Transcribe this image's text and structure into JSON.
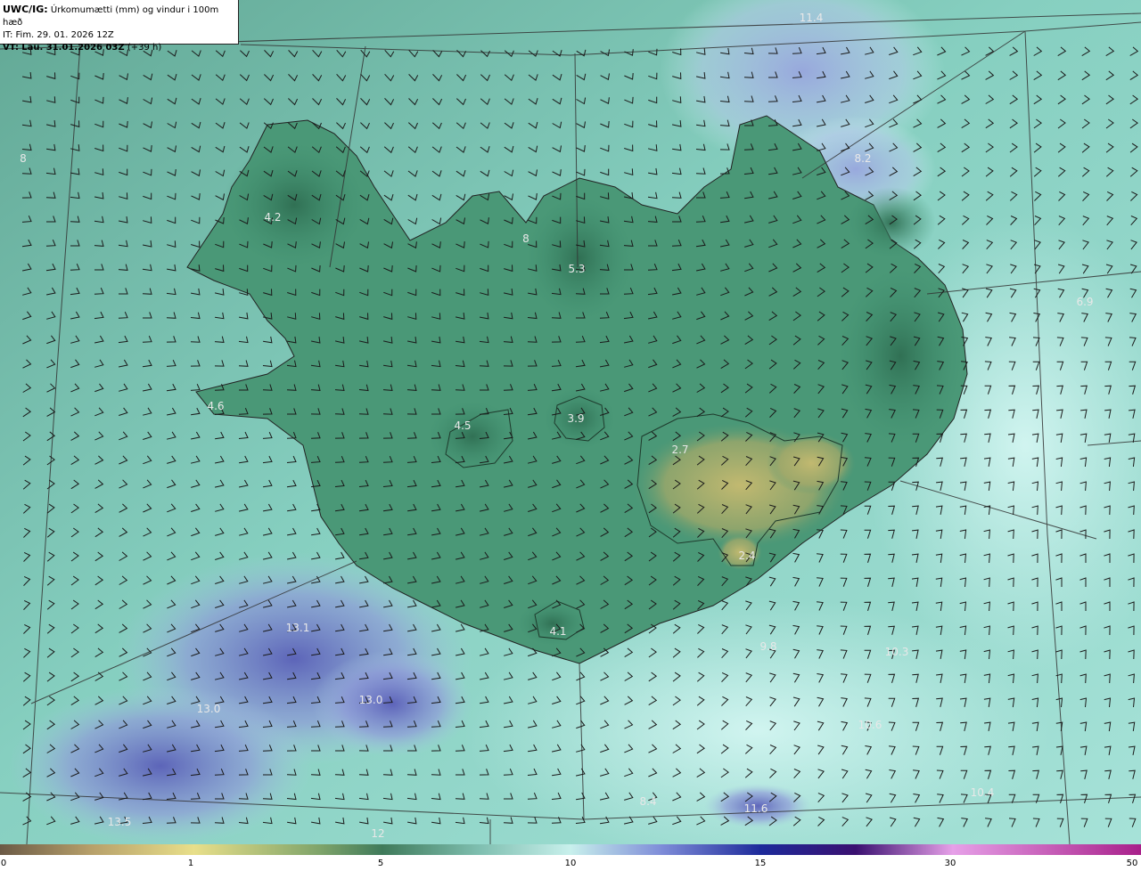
{
  "header": {
    "product": "UWC/IG:",
    "title": "Úrkomumætti (mm) og vindur i 100m hæð",
    "init_prefix": "IT:",
    "init_time": "Fim. 29. 01. 2026 12Z",
    "valid_prefix": "VT:",
    "valid_time": "Lau. 31.01.2026 03Z",
    "lead": "(+39 h)"
  },
  "colorbar": {
    "ticks": [
      {
        "label": "0",
        "value": 0
      },
      {
        "label": "1",
        "value": 1
      },
      {
        "label": "5",
        "value": 5
      },
      {
        "label": "10",
        "value": 10
      },
      {
        "label": "15",
        "value": 15
      },
      {
        "label": "30",
        "value": 30
      },
      {
        "label": "50",
        "value": 50
      }
    ],
    "colors": [
      "#6b5a46",
      "#b7a06a",
      "#e8df8a",
      "#3f7a5a",
      "#7fbfb0",
      "#c8f0ec",
      "#7e8cd8",
      "#1d2a9a",
      "#3a1070",
      "#e6a0e8",
      "#a8208a"
    ]
  },
  "map": {
    "ocean_color": "#7fc6b8",
    "land_color": "#3e8e6e",
    "dry_color": "#b9b36c",
    "wet_color": "#7a86d0",
    "value_labels": [
      "11.4",
      "4.2",
      "8",
      "5.3",
      "3.9",
      "4.6",
      "4.5",
      "2.7",
      "2.4",
      "4.1",
      "6.9",
      "13.1",
      "13.0",
      "13.0",
      "13.5",
      "9.8",
      "10.3",
      "10.6",
      "10.4",
      "8.4",
      "8.2",
      "11.6",
      "8",
      "12"
    ]
  }
}
